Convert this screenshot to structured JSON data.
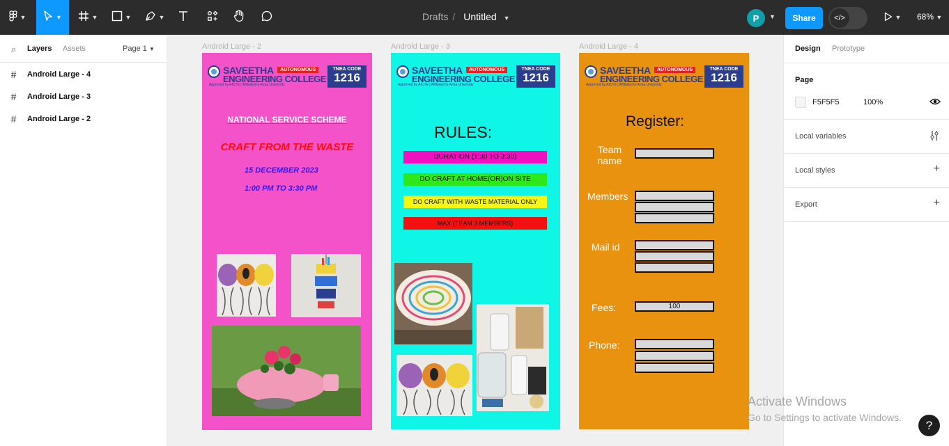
{
  "toolbar": {
    "breadcrumb_parent": "Drafts",
    "file_name": "Untitled",
    "avatar_initial": "P",
    "share_label": "Share",
    "zoom": "68%"
  },
  "left_panel": {
    "tab_layers": "Layers",
    "tab_assets": "Assets",
    "page_select": "Page 1",
    "layers": [
      "Android Large - 4",
      "Android Large - 3",
      "Android Large - 2"
    ]
  },
  "right_panel": {
    "tab_design": "Design",
    "tab_prototype": "Prototype",
    "page_heading": "Page",
    "page_color": "F5F5F5",
    "page_opacity": "100%",
    "local_variables": "Local variables",
    "local_styles": "Local styles",
    "export": "Export"
  },
  "logo": {
    "name_line1": "SAVEETHA",
    "name_line2": "ENGINEERING COLLEGE",
    "autonomous": "AUTONOMOUS",
    "approved": "Approved by AICTE  |  Affiliated to Anna University",
    "tnea_label": "TNEA CODE",
    "tnea_code": "1216"
  },
  "frames": {
    "frame2": {
      "label": "Android Large - 2",
      "bg": "#f452c8",
      "heading": "NATIONAL SERVICE SCHEME",
      "title": "CRAFT FROM THE WASTE",
      "date": "15 DECEMBER 2023",
      "time": "1:00 PM TO 3:30 PM"
    },
    "frame3": {
      "label": "Android Large - 3",
      "bg": "#0ff5e6",
      "heading": "RULES:",
      "rules": [
        {
          "text": "DURATION (1:30 TO 3:30)",
          "color": "#f20fbf"
        },
        {
          "text": "DO CRAFT AT HOME(OR)ON SITE",
          "color": "#2ee81b"
        },
        {
          "text": "DO CRAFT WITH WASTE MATERIAL ONLY",
          "color": "#f6f614"
        },
        {
          "text": "MAX (TEAM 3 MEMBERS)",
          "color": "#f51010"
        }
      ]
    },
    "frame4": {
      "label": "Android Large - 4",
      "bg": "#e8920f",
      "heading": "Register:",
      "team_label": "Team name",
      "members_label": "Members",
      "mail_label": "Mail id",
      "fees_label": "Fees:",
      "fees_value": "100",
      "phone_label": "Phone:"
    }
  },
  "watermark": {
    "line1": "Activate Windows",
    "line2": "Go to Settings to activate Windows."
  },
  "help_label": "?"
}
